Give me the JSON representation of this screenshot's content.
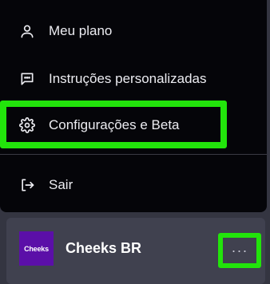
{
  "menu": {
    "items": [
      {
        "label": "Meu plano",
        "icon": "user-icon"
      },
      {
        "label": "Instruções personalizadas",
        "icon": "chat-icon"
      },
      {
        "label": "Configurações e Beta",
        "icon": "gear-icon"
      },
      {
        "label": "Sair",
        "icon": "logout-icon"
      }
    ]
  },
  "account": {
    "avatar_text": "Cheeks",
    "name": "Cheeks BR",
    "more_label": "···"
  },
  "colors": {
    "highlight": "#22e40b",
    "menu_bg": "#050509",
    "footer_bg": "#40414f",
    "avatar_bg": "#5b0fa8"
  }
}
